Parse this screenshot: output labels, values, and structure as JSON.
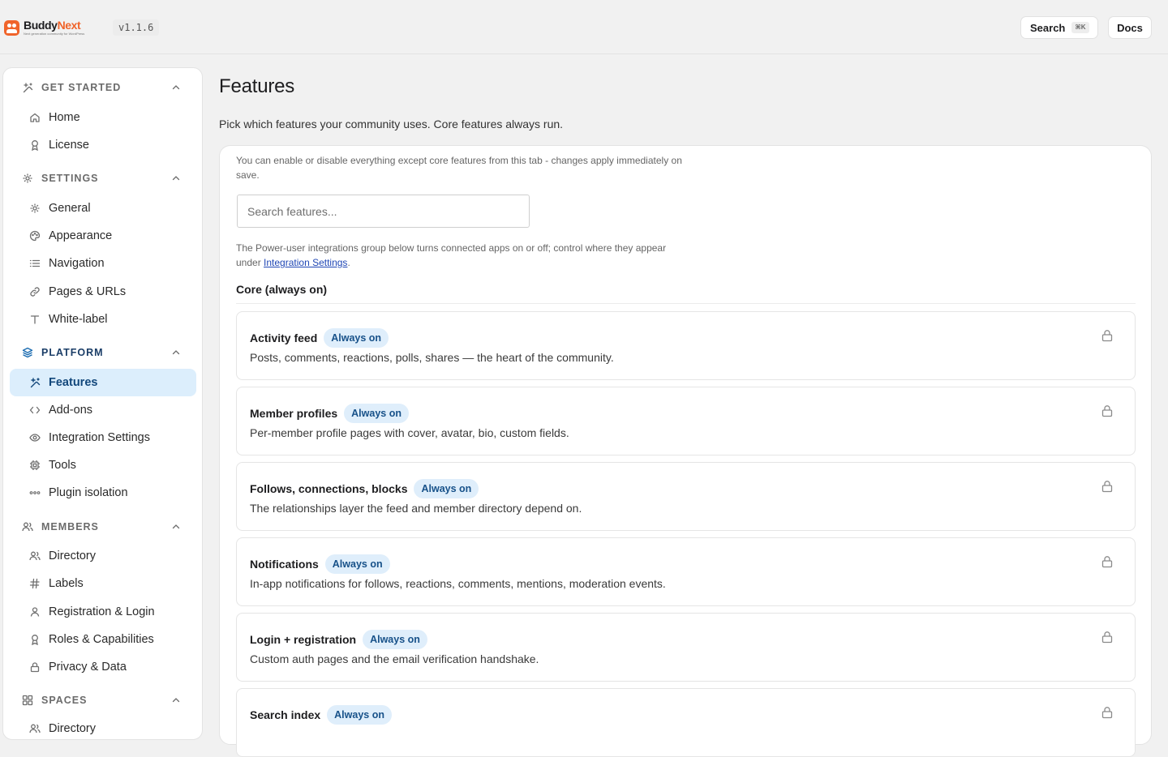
{
  "app": {
    "logo_name_part1": "Buddy",
    "logo_name_part2": "Next",
    "logo_tagline": "Next generation community for WordPress",
    "version": "v1.1.6"
  },
  "topbar": {
    "search_label": "Search",
    "search_shortcut": "⌘K",
    "docs_label": "Docs"
  },
  "sidebar": {
    "groups": [
      {
        "label": "GET STARTED",
        "icon": "sparkles-icon",
        "items": [
          {
            "label": "Home",
            "icon": "home-icon"
          },
          {
            "label": "License",
            "icon": "award-icon"
          }
        ]
      },
      {
        "label": "SETTINGS",
        "icon": "gear-icon",
        "items": [
          {
            "label": "General",
            "icon": "gear-icon"
          },
          {
            "label": "Appearance",
            "icon": "palette-icon"
          },
          {
            "label": "Navigation",
            "icon": "list-icon"
          },
          {
            "label": "Pages & URLs",
            "icon": "link-icon"
          },
          {
            "label": "White-label",
            "icon": "type-icon"
          }
        ]
      },
      {
        "label": "PLATFORM",
        "icon": "layers-icon",
        "active": true,
        "items": [
          {
            "label": "Features",
            "icon": "sparkles-icon",
            "selected": true
          },
          {
            "label": "Add-ons",
            "icon": "code-icon"
          },
          {
            "label": "Integration Settings",
            "icon": "eye-icon"
          },
          {
            "label": "Tools",
            "icon": "cpu-icon"
          },
          {
            "label": "Plugin isolation",
            "icon": "dots-icon"
          }
        ]
      },
      {
        "label": "MEMBERS",
        "icon": "users-icon",
        "items": [
          {
            "label": "Directory",
            "icon": "users-icon"
          },
          {
            "label": "Labels",
            "icon": "hash-icon"
          },
          {
            "label": "Registration & Login",
            "icon": "user-icon"
          },
          {
            "label": "Roles & Capabilities",
            "icon": "award-icon"
          },
          {
            "label": "Privacy & Data",
            "icon": "lock-icon"
          }
        ]
      },
      {
        "label": "SPACES",
        "icon": "grid-icon",
        "items": [
          {
            "label": "Directory",
            "icon": "users-icon"
          }
        ]
      }
    ]
  },
  "main": {
    "title": "Features",
    "subtitle": "Pick which features your community uses. Core features always run.",
    "note_top": "You can enable or disable everything except core features from this tab - changes apply immediately on save.",
    "search_placeholder": "Search features...",
    "note_integrations_prefix": "The Power-user integrations group below turns connected apps on or off; control where they appear under ",
    "note_integrations_link": "Integration Settings",
    "note_integrations_suffix": ".",
    "section_title": "Core (always on)",
    "features": [
      {
        "name": "Activity feed",
        "badge": "Always on",
        "description": "Posts, comments, reactions, polls, shares — the heart of the community."
      },
      {
        "name": "Member profiles",
        "badge": "Always on",
        "description": "Per-member profile pages with cover, avatar, bio, custom fields."
      },
      {
        "name": "Follows, connections, blocks",
        "badge": "Always on",
        "description": "The relationships layer the feed and member directory depend on."
      },
      {
        "name": "Notifications",
        "badge": "Always on",
        "description": "In-app notifications for follows, reactions, comments, mentions, moderation events."
      },
      {
        "name": "Login + registration",
        "badge": "Always on",
        "description": "Custom auth pages and the email verification handshake."
      },
      {
        "name": "Search index",
        "badge": "Always on",
        "description": ""
      }
    ]
  },
  "colors": {
    "brand": "#f0642b",
    "accent_bg": "#dceefc",
    "accent_text": "#12477b",
    "link": "#2047b5"
  }
}
